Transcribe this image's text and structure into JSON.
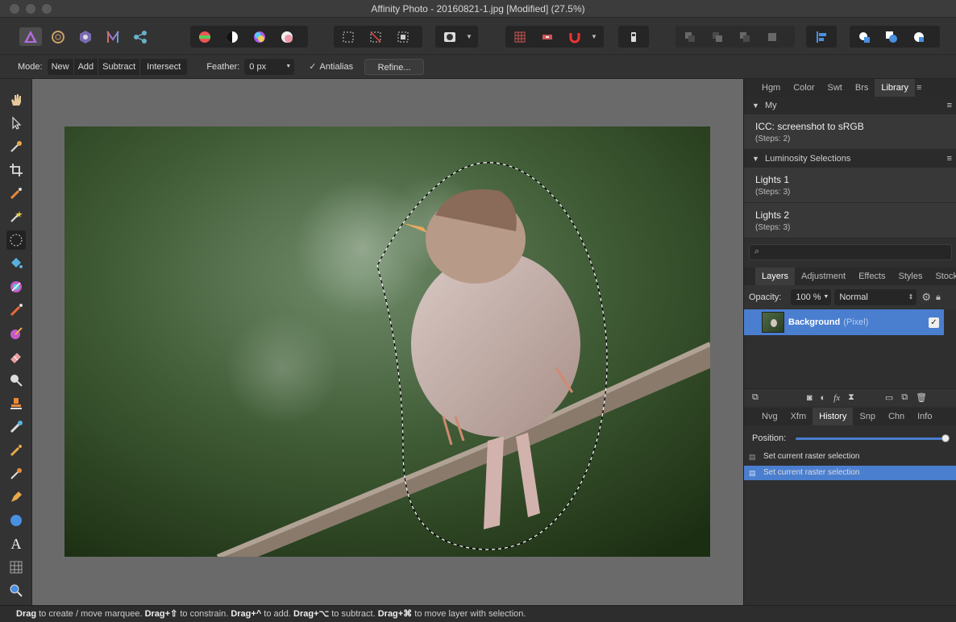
{
  "window": {
    "title": "Affinity Photo - 20160821-1.jpg [Modified] (27.5%)"
  },
  "context_toolbar": {
    "mode_label": "Mode:",
    "modes": [
      "New",
      "Add",
      "Subtract",
      "Intersect"
    ],
    "feather_label": "Feather:",
    "feather_value": "0 px",
    "antialias_label": "Antialias",
    "refine_label": "Refine..."
  },
  "library_panel": {
    "tabs": [
      "Hgm",
      "Color",
      "Swt",
      "Brs",
      "Library"
    ],
    "active_tab": "Library",
    "sections": [
      {
        "name": "My",
        "items": [
          {
            "name": "ICC: screenshot to sRGB",
            "steps": "(Steps: 2)"
          }
        ]
      },
      {
        "name": "Luminosity Selections",
        "items": [
          {
            "name": "Lights 1",
            "steps": "(Steps: 3)"
          },
          {
            "name": "Lights 2",
            "steps": "(Steps: 3)"
          }
        ]
      }
    ]
  },
  "layers_panel": {
    "tabs": [
      "Layers",
      "Adjustment",
      "Effects",
      "Styles",
      "Stock"
    ],
    "active_tab": "Layers",
    "opacity_label": "Opacity:",
    "opacity_value": "100 %",
    "blend_mode": "Normal",
    "layer_name": "Background",
    "layer_type": "(Pixel)"
  },
  "history_panel": {
    "tabs": [
      "Nvg",
      "Xfm",
      "History",
      "Snp",
      "Chn",
      "Info"
    ],
    "active_tab": "History",
    "position_label": "Position:",
    "position_value": 1.0,
    "entries": [
      "Set current raster selection",
      "Set current raster selection"
    ]
  },
  "status_bar": {
    "parts": [
      {
        "bold": "Drag",
        "text": " to create / move marquee. "
      },
      {
        "bold": "Drag+⇧",
        "text": " to constrain. "
      },
      {
        "bold": "Drag+^",
        "text": " to add. "
      },
      {
        "bold": "Drag+⌥",
        "text": " to subtract. "
      },
      {
        "bold": "Drag+⌘",
        "text": " to move layer with selection."
      }
    ]
  },
  "colors": {
    "accent": "#4a7ecf",
    "selection_row": "#4a7ecf",
    "canvas_bg": "#6a6a6a"
  }
}
